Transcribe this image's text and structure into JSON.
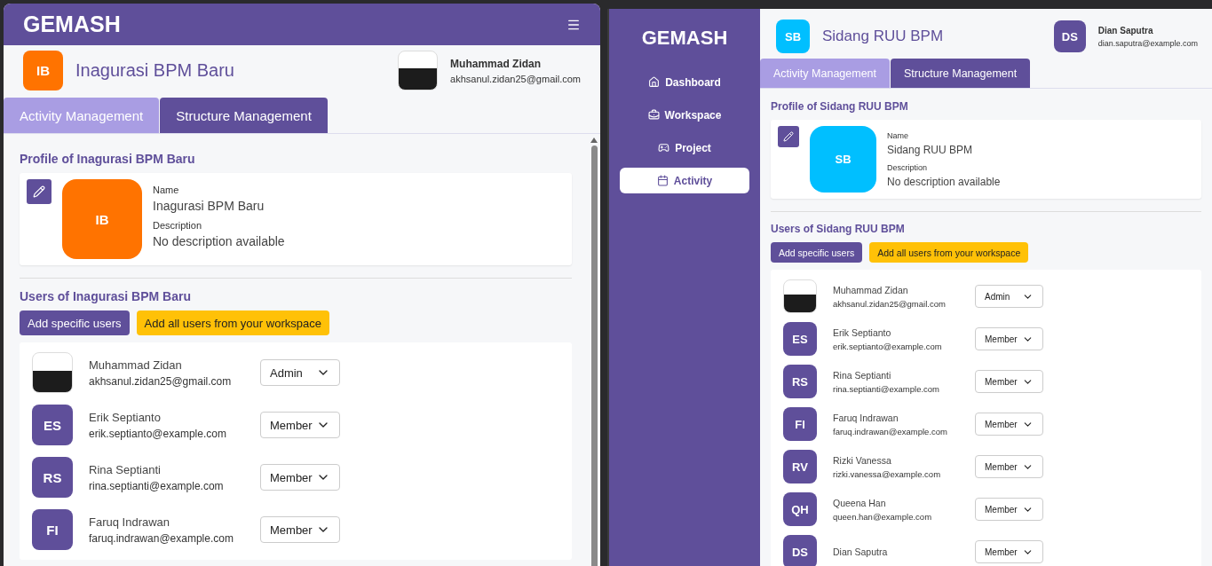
{
  "panels": [
    {
      "kind": "mobile",
      "brand": "GEMASH",
      "activity": {
        "initials": "IB",
        "card_initials": "IB",
        "color": "#ff7300",
        "title": "Inagurasi BPM Baru"
      },
      "current_user": {
        "kind": "photo",
        "name": "Muhammad Zidan",
        "email": "akhsanul.zidan25@gmail.com"
      },
      "tabs": [
        {
          "label": "Activity Management",
          "selected": true
        },
        {
          "label": "Structure Management",
          "selected": false
        }
      ],
      "profile": {
        "heading": "Profile of Inagurasi BPM Baru",
        "name_label": "Name",
        "name": "Inagurasi BPM Baru",
        "description_label": "Description",
        "description": "No description available"
      },
      "users": {
        "heading": "Users of Inagurasi BPM Baru",
        "buttons": [
          {
            "label": "Add specific users",
            "kind": "primary"
          },
          {
            "label": "Add all users from your workspace",
            "kind": "warning"
          }
        ],
        "members": [
          {
            "kind": "photo",
            "name": "Muhammad Zidan",
            "email": "akhsanul.zidan25@gmail.com",
            "role": "Admin"
          },
          {
            "kind": "initials",
            "initials": "ES",
            "name": "Erik Septianto",
            "email": "erik.septianto@example.com",
            "role": "Member"
          },
          {
            "kind": "initials",
            "initials": "RS",
            "name": "Rina Septianti",
            "email": "rina.septianti@example.com",
            "role": "Member"
          },
          {
            "kind": "initials",
            "initials": "FI",
            "name": "Faruq Indrawan",
            "email": "faruq.indrawan@example.com",
            "role": "Member"
          }
        ]
      }
    },
    {
      "kind": "desktop",
      "brand": "GEMASH",
      "nav": [
        {
          "label": "Dashboard",
          "selected": false
        },
        {
          "label": "Workspace",
          "selected": false
        },
        {
          "label": "Project",
          "selected": false
        },
        {
          "label": "Activity",
          "selected": true
        }
      ],
      "activity": {
        "initials": "SB",
        "card_initials": "SB",
        "color": "#00bfff",
        "title": "Sidang RUU BPM"
      },
      "current_user": {
        "kind": "initials",
        "initials": "DS",
        "name": "Dian Saputra",
        "email": "dian.saputra@example.com"
      },
      "tabs": [
        {
          "label": "Activity Management",
          "selected": true
        },
        {
          "label": "Structure Management",
          "selected": false
        }
      ],
      "profile": {
        "heading": "Profile of Sidang RUU BPM",
        "name_label": "Name",
        "name": "Sidang RUU BPM",
        "description_label": "Description",
        "description": "No description available"
      },
      "users": {
        "heading": "Users of Sidang RUU BPM",
        "buttons": [
          {
            "label": "Add specific users",
            "kind": "primary"
          },
          {
            "label": "Add all users from your workspace",
            "kind": "warning"
          }
        ],
        "members": [
          {
            "kind": "photo",
            "name": "Muhammad Zidan",
            "email": "akhsanul.zidan25@gmail.com",
            "role": "Admin"
          },
          {
            "kind": "initials",
            "initials": "ES",
            "name": "Erik Septianto",
            "email": "erik.septianto@example.com",
            "role": "Member"
          },
          {
            "kind": "initials",
            "initials": "RS",
            "name": "Rina Septianti",
            "email": "rina.septianti@example.com",
            "role": "Member"
          },
          {
            "kind": "initials",
            "initials": "FI",
            "name": "Faruq Indrawan",
            "email": "faruq.indrawan@example.com",
            "role": "Member"
          },
          {
            "kind": "initials",
            "initials": "RV",
            "name": "Rizki Vanessa",
            "email": "rizki.vanessa@example.com",
            "role": "Member"
          },
          {
            "kind": "initials",
            "initials": "QH",
            "name": "Queena Han",
            "email": "queen.han@example.com",
            "role": "Member"
          },
          {
            "kind": "initials",
            "initials": "DS",
            "name": "Dian Saputra",
            "role": "Member"
          }
        ]
      }
    }
  ]
}
